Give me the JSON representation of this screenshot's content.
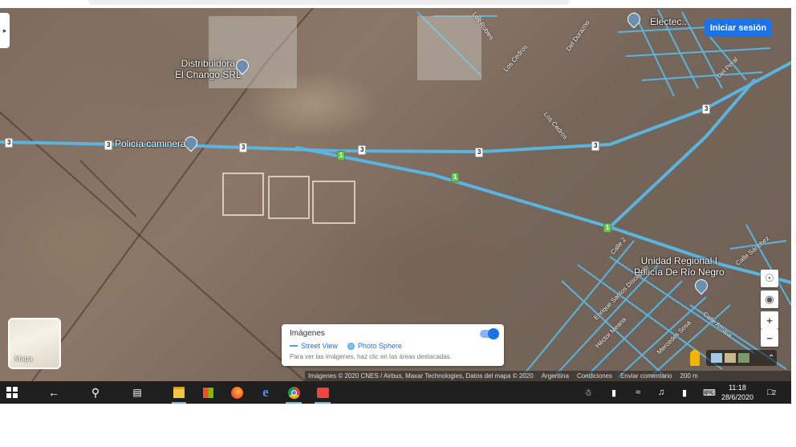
{
  "map": {
    "places": [
      {
        "name": "Distribuidora\nEl Chango SRL"
      },
      {
        "name": "Policía caminera"
      },
      {
        "name": "Unidad Regional I\nPolicía De Río Negro"
      },
      {
        "name": "Electec..."
      }
    ],
    "streets": [
      "Los Robles",
      "Los Cedros",
      "Los Cedros",
      "Del Durazno",
      "Calle 2",
      "Enrique Santos Discépolo",
      "Héctor Meana",
      "Mercedes Sosa",
      "Calle Amalia",
      "Calle Sánchez",
      "Del Peral"
    ],
    "route_shields": [
      "3",
      "3",
      "3",
      "3",
      "3",
      "3",
      "3",
      "1",
      "1",
      "1"
    ],
    "login_label": "Iniciar sesión",
    "mini_map_label": "Mapa"
  },
  "imagery_panel": {
    "title": "Imágenes",
    "street_view": "Street View",
    "photo_sphere": "Photo Sphere",
    "hint": "Para ver las imágenes, haz clic en las áreas destacadas.",
    "toggle_on": true
  },
  "footer": {
    "attribution": "Imágenes © 2020 CNES / Airbus, Maxar Technologies, Datos del mapa © 2020",
    "country": "Argentina",
    "terms": "Condiciones",
    "feedback": "Enviar comentario",
    "scale": "200 m"
  },
  "map_controls": [
    "globe-icon",
    "my-location-icon",
    "zoom-in-icon",
    "zoom-out-icon"
  ],
  "taskbar": {
    "time": "11:18",
    "date": "28/6/2020",
    "notification_count": "2",
    "apps": [
      "start-icon",
      "back-icon",
      "search-icon",
      "task-view-icon",
      "file-explorer-icon",
      "store-icon",
      "firefox-icon",
      "edge-icon",
      "chrome-icon",
      "anydesk-icon"
    ]
  },
  "colors": {
    "road": "#5ab4e0",
    "accent": "#1a73e8",
    "taskbar": "#1f1f1f"
  }
}
